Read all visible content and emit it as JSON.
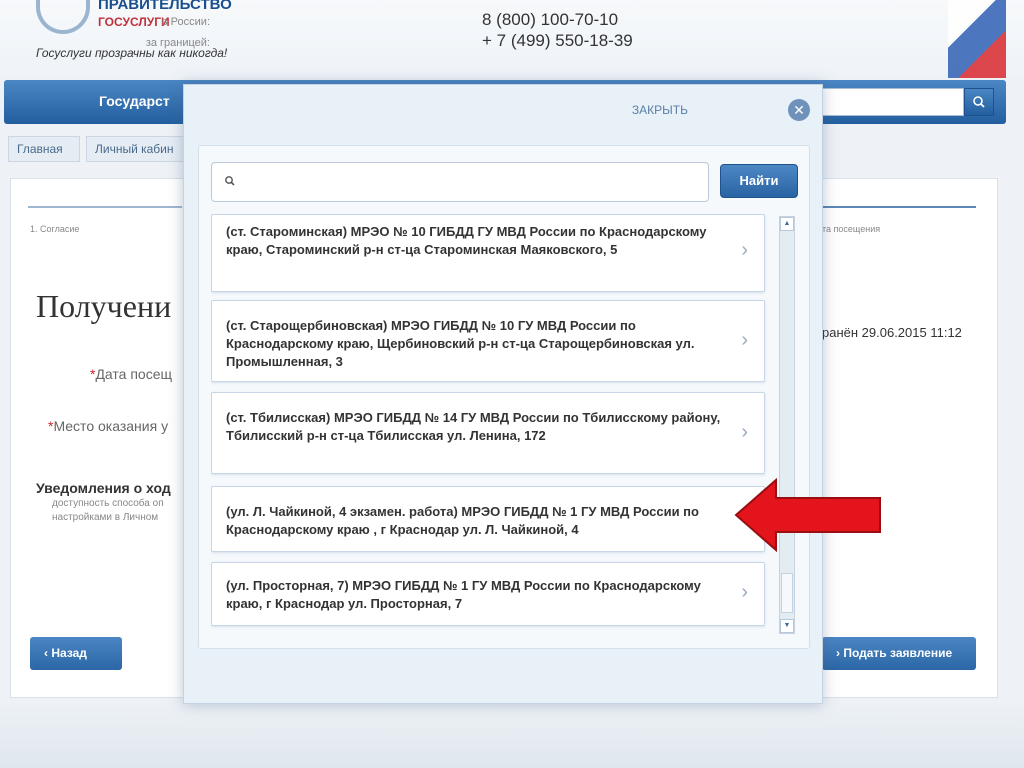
{
  "header": {
    "logo_line1": "ПРАВИТЕЛЬСТВО",
    "logo_line2": "ГОСУСЛУГИ",
    "slogan": "Госуслуги прозрачны как никогда!",
    "phone_russia_label": "в России:",
    "phone_russia": "8 (800) 100-70-10",
    "phone_abroad_label": "за границей:",
    "phone_abroad": "+ 7 (499) 550-18-39"
  },
  "nav": {
    "item_label": "Государст"
  },
  "breadcrumb": [
    "Главная",
    "Личный кабин"
  ],
  "page": {
    "step_left": "1. Согласие",
    "step_right": "та посещения",
    "heading": "Получени",
    "visit_date_label": "Дата посещ",
    "place_label": "Место оказания у",
    "saved_text": "ранён 29.06.2015 11:12",
    "notifications_title": "Уведомления о ход",
    "notifications_line1": "доступность способа оп",
    "notifications_line2": "настройками в Личном",
    "back_button": "Назад",
    "submit_button": "Подать заявление"
  },
  "modal": {
    "close_label": "ЗАКРЫТЬ",
    "search_placeholder": "",
    "search_value": "",
    "find_button": "Найти",
    "items": [
      "(ст. Староминская) МРЭО № 10 ГИБДД ГУ МВД России по Краснодарскому краю, Староминский р-н ст-ца Староминская Маяковского, 5",
      "(ст. Старощербиновская) МРЭО ГИБДД № 10 ГУ МВД России по Краснодарскому краю, Щербиновский р-н ст-ца Старощербиновская ул. Промышленная, 3",
      "(ст. Тбилисская) МРЭО ГИБДД № 14 ГУ МВД России по Тбилисскому району, Тбилисский р-н ст-ца Тбилисская ул. Ленина, 172",
      "(ул. Л. Чайкиной, 4 экзамен. работа) МРЭО ГИБДД № 1 ГУ МВД России по Краснодарскому краю , г Краснодар ул. Л. Чайкиной, 4",
      "(ул. Просторная, 7) МРЭО ГИБДД № 1 ГУ МВД России по Краснодарскому краю, г Краснодар ул. Просторная, 7"
    ]
  },
  "colors": {
    "nav_blue": "#2f6aa9",
    "button_blue": "#3a74b3",
    "required_red": "#d2232a",
    "arrow_red": "#e3141b"
  },
  "icons": {
    "search": "search-icon",
    "close": "close-icon",
    "chevron": "chevron-right-icon",
    "arrow": "red-pointer-arrow"
  }
}
